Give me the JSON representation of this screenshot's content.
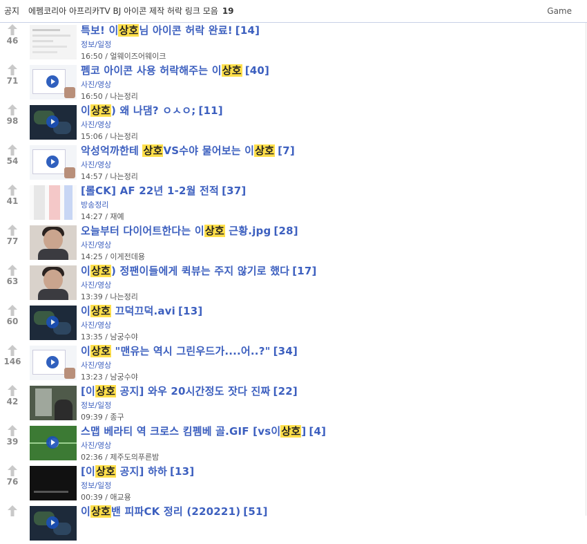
{
  "notice": {
    "tag": "공지",
    "title": "에펨코리아 아프리카TV BJ 아이콘 제작 허락 링크 모음",
    "count": "19",
    "category": "Game"
  },
  "highlight_term": "상호",
  "posts": [
    {
      "votes": "46",
      "thumb": "white",
      "parts": [
        [
          "특보! 이",
          ""
        ],
        [
          "상호",
          "hl"
        ],
        [
          "님 아이콘 허락 완료!",
          ""
        ]
      ],
      "comments": "[14]",
      "category": "정보/일정",
      "time": "16:50",
      "author": "얼웨이즈어웨이크"
    },
    {
      "votes": "71",
      "thumb": "browser",
      "parts": [
        [
          "펨코 아이콘 사용 허락해주는 이",
          ""
        ],
        [
          "상호",
          "hl"
        ]
      ],
      "comments": "[40]",
      "category": "사진/영상",
      "time": "16:50",
      "author": "나는정리"
    },
    {
      "votes": "98",
      "thumb": "game",
      "parts": [
        [
          "이",
          ""
        ],
        [
          "상호",
          "hl"
        ],
        [
          ") 왜 나댐? ㅇㅅㅇ;",
          ""
        ]
      ],
      "comments": "[11]",
      "category": "사진/영상",
      "time": "15:06",
      "author": "나는정리"
    },
    {
      "votes": "54",
      "thumb": "browser",
      "parts": [
        [
          "악성억까한테 ",
          ""
        ],
        [
          "상호",
          "hl"
        ],
        [
          "VS수야 물어보는 이",
          ""
        ],
        [
          "상호",
          "hl"
        ]
      ],
      "comments": "[7]",
      "category": "사진/영상",
      "time": "14:57",
      "author": "나는정리"
    },
    {
      "votes": "41",
      "thumb": "sheet",
      "parts": [
        [
          "[롤CK] AF 22년 1-2월 전적",
          ""
        ]
      ],
      "comments": "[37]",
      "category": "방송정리",
      "time": "14:27",
      "author": "재예"
    },
    {
      "votes": "77",
      "thumb": "face",
      "parts": [
        [
          "오늘부터 다이어트한다는 이",
          ""
        ],
        [
          "상호",
          "hl"
        ],
        [
          " 근황.jpg",
          ""
        ]
      ],
      "comments": "[28]",
      "category": "사진/영상",
      "time": "14:25",
      "author": "이게전데용"
    },
    {
      "votes": "63",
      "thumb": "face",
      "parts": [
        [
          "이",
          ""
        ],
        [
          "상호",
          "hl"
        ],
        [
          ") 정팬이들에게 퀵뷰는 주지 않기로 했다",
          ""
        ]
      ],
      "comments": "[17]",
      "category": "사진/영상",
      "time": "13:39",
      "author": "나는정리"
    },
    {
      "votes": "60",
      "thumb": "game",
      "parts": [
        [
          "이",
          ""
        ],
        [
          "상호",
          "hl"
        ],
        [
          " 끄덕끄덕.avi",
          ""
        ]
      ],
      "comments": "[13]",
      "category": "사진/영상",
      "time": "13:35",
      "author": "남궁수야"
    },
    {
      "votes": "146",
      "thumb": "browser",
      "parts": [
        [
          "이",
          ""
        ],
        [
          "상호",
          "hl"
        ],
        [
          " \"맨유는 역시 그린우드가....어..?\"",
          ""
        ]
      ],
      "comments": "[34]",
      "category": "사진/영상",
      "time": "13:23",
      "author": "남궁수야"
    },
    {
      "votes": "42",
      "thumb": "photo",
      "parts": [
        [
          "[이",
          ""
        ],
        [
          "상호",
          "hl"
        ],
        [
          " 공지] 와우 20시간정도 잣다 진짜",
          ""
        ]
      ],
      "comments": "[22]",
      "category": "정보/일정",
      "time": "09:39",
      "author": "종구"
    },
    {
      "votes": "39",
      "thumb": "soccer",
      "parts": [
        [
          "스맵 베라티 역 크로스 킴펨베 골.GIF [vs이",
          ""
        ],
        [
          "상호",
          "hl"
        ],
        [
          "]",
          ""
        ]
      ],
      "comments": "[4]",
      "category": "사진/영상",
      "time": "02:36",
      "author": "제주도의푸른밤"
    },
    {
      "votes": "76",
      "thumb": "dark",
      "parts": [
        [
          "[이",
          ""
        ],
        [
          "상호",
          "hl"
        ],
        [
          " 공지] 하하",
          ""
        ]
      ],
      "comments": "[13]",
      "category": "정보/일정",
      "time": "00:39",
      "author": "애교용"
    },
    {
      "votes": "",
      "thumb": "game",
      "parts": [
        [
          "이",
          ""
        ],
        [
          "상호",
          "hl"
        ],
        [
          "밴 피파CK 정리 (220221)",
          ""
        ]
      ],
      "comments": "[51]",
      "category": "",
      "time": "",
      "author": ""
    }
  ]
}
